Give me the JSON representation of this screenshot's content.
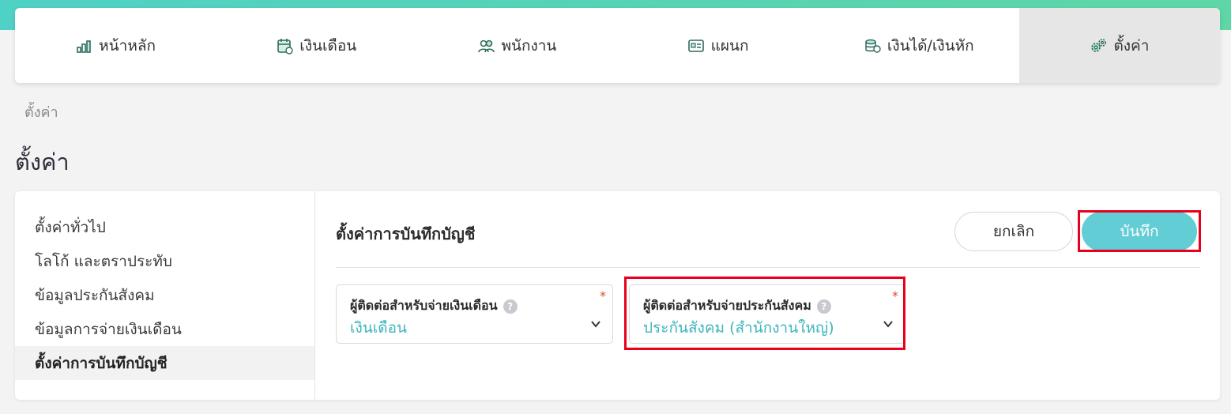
{
  "nav": {
    "items": [
      {
        "label": "หน้าหลัก",
        "icon": "chart-icon"
      },
      {
        "label": "เงินเดือน",
        "icon": "calendar-icon"
      },
      {
        "label": "พนักงาน",
        "icon": "users-icon"
      },
      {
        "label": "แผนก",
        "icon": "id-card-icon"
      },
      {
        "label": "เงินได้/เงินหัก",
        "icon": "money-icon"
      },
      {
        "label": "ตั้งค่า",
        "icon": "gear-icon"
      }
    ],
    "active_index": 5
  },
  "breadcrumb": "ตั้งค่า",
  "page_title": "ตั้งค่า",
  "sidebar": {
    "items": [
      {
        "label": "ตั้งค่าทั่วไป"
      },
      {
        "label": "โลโก้ และตราประทับ"
      },
      {
        "label": "ข้อมูลประกันสังคม"
      },
      {
        "label": "ข้อมูลการจ่ายเงินเดือน"
      },
      {
        "label": "ตั้งค่าการบันทึกบัญชี"
      }
    ],
    "active_index": 4
  },
  "content": {
    "title": "ตั้งค่าการบันทึกบัญชี",
    "cancel_label": "ยกเลิก",
    "save_label": "บันทึก",
    "fields": [
      {
        "label": "ผู้ติดต่อสำหรับจ่ายเงินเดือน",
        "value": "เงินเดือน",
        "required_mark": "*",
        "help": "?"
      },
      {
        "label": "ผู้ติดต่อสำหรับจ่ายประกันสังคม",
        "value": "ประกันสังคม (สำนักงานใหญ่)",
        "required_mark": "*",
        "help": "?"
      }
    ]
  },
  "colors": {
    "accent": "#62cdd4",
    "value_text": "#3fb5bd",
    "highlight": "#e8001c",
    "top_strip": "#4fd1c5"
  }
}
